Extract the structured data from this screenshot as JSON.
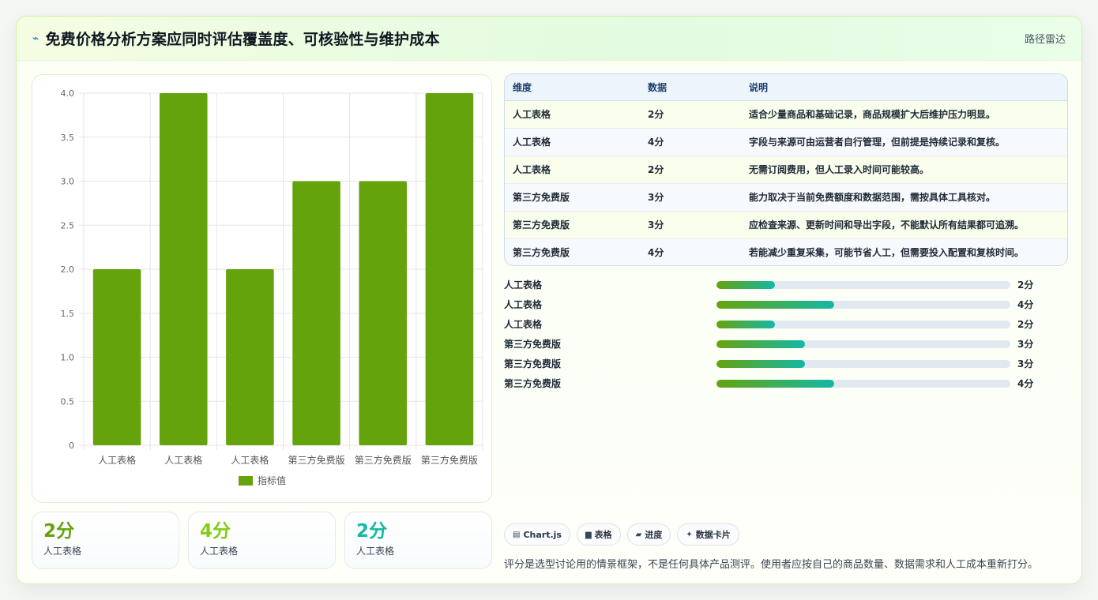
{
  "header": {
    "title": "免费价格分析方案应同时评估覆盖度、可核验性与维护成本",
    "icon": "route-icon",
    "right_label": "路径雷达"
  },
  "colors": {
    "bar": "#65a30d",
    "stat_1": "#65a30d",
    "stat_2": "#84cc16",
    "stat_3": "#14b8a6",
    "progress_start": "#65a30d",
    "progress_end": "#14b8a6"
  },
  "chart_data": {
    "type": "bar",
    "categories": [
      "人工表格",
      "人工表格",
      "人工表格",
      "第三方免费版",
      "第三方免费版",
      "第三方免费版"
    ],
    "series": [
      {
        "name": "指标值",
        "values": [
          2,
          4,
          2,
          3,
          3,
          4
        ]
      }
    ],
    "yticks": [
      "0",
      "0.5",
      "1.0",
      "1.5",
      "2.0",
      "2.5",
      "3.0",
      "3.5",
      "4.0"
    ],
    "ylim": [
      0,
      4
    ],
    "grid": true,
    "legend_position": "bottom"
  },
  "stats": [
    {
      "value": "2分",
      "label": "人工表格"
    },
    {
      "value": "4分",
      "label": "人工表格"
    },
    {
      "value": "2分",
      "label": "人工表格"
    }
  ],
  "table": {
    "headers": [
      "维度",
      "数据",
      "说明"
    ],
    "rows": [
      [
        "人工表格",
        "2分",
        "适合少量商品和基础记录，商品规模扩大后维护压力明显。"
      ],
      [
        "人工表格",
        "4分",
        "字段与来源可由运营者自行管理，但前提是持续记录和复核。"
      ],
      [
        "人工表格",
        "2分",
        "无需订阅费用，但人工录入时间可能较高。"
      ],
      [
        "第三方免费版",
        "3分",
        "能力取决于当前免费额度和数据范围，需按具体工具核对。"
      ],
      [
        "第三方免费版",
        "3分",
        "应检查来源、更新时间和导出字段，不能默认所有结果都可追溯。"
      ],
      [
        "第三方免费版",
        "4分",
        "若能减少重复采集，可能节省人工，但需要投入配置和复核时间。"
      ]
    ]
  },
  "progress": {
    "max": 10,
    "items": [
      {
        "label": "人工表格",
        "value": 2,
        "display": "2分"
      },
      {
        "label": "人工表格",
        "value": 4,
        "display": "4分"
      },
      {
        "label": "人工表格",
        "value": 2,
        "display": "2分"
      },
      {
        "label": "第三方免费版",
        "value": 3,
        "display": "3分"
      },
      {
        "label": "第三方免费版",
        "value": 3,
        "display": "3分"
      },
      {
        "label": "第三方免费版",
        "value": 4,
        "display": "4分"
      }
    ]
  },
  "tags": [
    {
      "icon": "chart-icon",
      "label": "Chart.js"
    },
    {
      "icon": "table-icon",
      "label": "表格"
    },
    {
      "icon": "progress-icon",
      "label": "进度"
    },
    {
      "icon": "sparkle-icon",
      "label": "数据卡片"
    }
  ],
  "footnote": "评分是选型讨论用的情景框架，不是任何具体产品测评。使用者应按自己的商品数量、数据需求和人工成本重新打分。"
}
